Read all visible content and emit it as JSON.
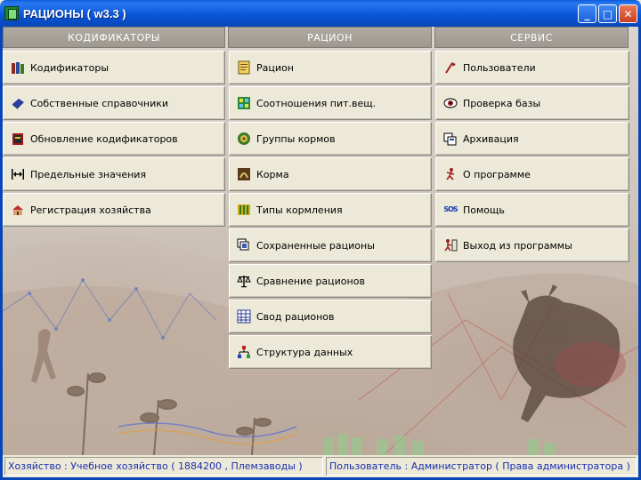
{
  "window": {
    "title": "РАЦИОНЫ ( w3.3 )",
    "controls": {
      "minimize": "_",
      "maximize": "□",
      "close": "✕"
    }
  },
  "columns": [
    {
      "header": "КОДИФИКАТОРЫ",
      "items": [
        {
          "label": "Кодификаторы",
          "icon": "books-icon"
        },
        {
          "label": "Собственные справочники",
          "icon": "book-icon"
        },
        {
          "label": "Обновление кодификаторов",
          "icon": "update-book-icon"
        },
        {
          "label": "Предельные значения",
          "icon": "range-limits-icon"
        },
        {
          "label": "Регистрация хозяйства",
          "icon": "farm-icon"
        }
      ]
    },
    {
      "header": "РАЦИОН",
      "items": [
        {
          "label": "Рацион",
          "icon": "ration-icon"
        },
        {
          "label": "Соотношения пит.вещ.",
          "icon": "nutrient-ratio-icon"
        },
        {
          "label": "Группы кормов",
          "icon": "feed-groups-icon"
        },
        {
          "label": "Корма",
          "icon": "feeds-icon"
        },
        {
          "label": "Типы кормления",
          "icon": "feeding-types-icon"
        },
        {
          "label": "Сохраненные рационы",
          "icon": "saved-rations-icon"
        },
        {
          "label": "Сравнение рационов",
          "icon": "scales-icon"
        },
        {
          "label": "Свод рационов",
          "icon": "summary-grid-icon"
        },
        {
          "label": "Структура данных",
          "icon": "data-structure-icon"
        }
      ]
    },
    {
      "header": "СЕРВИС",
      "items": [
        {
          "label": "Пользователи",
          "icon": "users-icon"
        },
        {
          "label": "Проверка базы",
          "icon": "eye-check-icon"
        },
        {
          "label": "Архивация",
          "icon": "archive-icon"
        },
        {
          "label": "О программе",
          "icon": "about-icon"
        },
        {
          "label": "Помощь",
          "icon": "sos-icon",
          "glyph_text": "SOS"
        },
        {
          "label": "Выход из программы",
          "icon": "exit-icon"
        }
      ]
    }
  ],
  "statusbar": {
    "farm": "Хозяйство : Учебное хозяйство ( 1884200 , Племзаводы )",
    "user": "Пользователь : Администратор ( Права администратора )"
  }
}
